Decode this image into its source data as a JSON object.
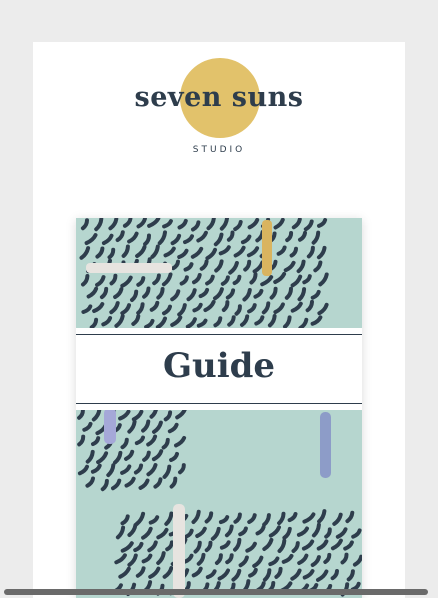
{
  "brand": {
    "name": "seven suns",
    "subtitle": "STUDIO",
    "sun_color": "#e2c26b"
  },
  "document": {
    "cover_title": "Guide",
    "cover_color": "#b6d6cf",
    "ink_color": "#2e3d4c"
  }
}
